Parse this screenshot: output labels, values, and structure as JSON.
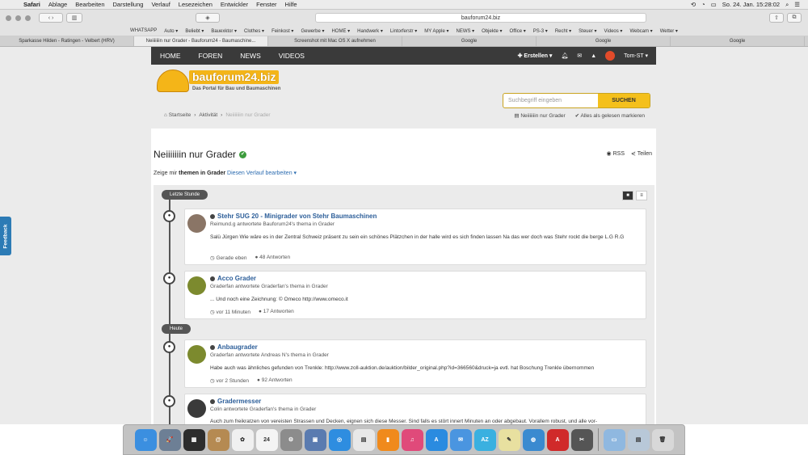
{
  "menubar": {
    "apple": "",
    "items": [
      "Safari",
      "Ablage",
      "Bearbeiten",
      "Darstellung",
      "Verlauf",
      "Lesezeichen",
      "Entwickler",
      "Fenster",
      "Hilfe"
    ],
    "clock": "So. 24. Jan.  15:28:02"
  },
  "toolbar": {
    "url": "bauforum24.biz"
  },
  "favorites": [
    "WHATSAPP",
    "Auto ▾",
    "Beliebt ▾",
    "Bauexktor ▾",
    "Clothes ▾",
    "Feinkost ▾",
    "Gewerbe ▾",
    "HOME ▾",
    "Handwerk ▾",
    "Lintorferstr ▾",
    "MY Apple ▾",
    "NEWS ▾",
    "Objekte ▾",
    "Office ▾",
    "PS-3 ▾",
    "Recht ▾",
    "Steuer ▾",
    "Videos ▾",
    "Webcam ▾",
    "Wetter ▾"
  ],
  "tabs": [
    {
      "label": "Sparkasse Hilden - Ratingen - Velbert (HRV)",
      "active": false
    },
    {
      "label": "Neiiiiiiin nur Grader - Bauforum24 - Baumaschine...",
      "active": true
    },
    {
      "label": "Screenshot mit Mac OS X aufnehmen",
      "active": false
    },
    {
      "label": "Google",
      "active": false
    },
    {
      "label": "Google",
      "active": false
    },
    {
      "label": "Google",
      "active": false
    }
  ],
  "feedback": "Feedback",
  "nav": {
    "items": [
      "HOME",
      "FOREN",
      "NEWS",
      "VIDEOS"
    ],
    "create": "✚ Erstellen ▾",
    "user": "Tom-ST ▾"
  },
  "logo": {
    "brand": "bauforum24.biz",
    "tagline": "Das Portal für Bau und Baumaschinen"
  },
  "search": {
    "placeholder": "Suchbegriff eingeben",
    "button": "SUCHEN"
  },
  "breadcrumb": {
    "home": "⌂ Startseite",
    "sep": "›",
    "activity": "Aktivität",
    "current": "Neiiiiiiin nur Grader"
  },
  "crumb_actions": {
    "stream": "▤ Neiiiiiiin nur Grader",
    "mark_read": "✔ Alles als gelesen markieren"
  },
  "page": {
    "title": "Neiiiiiiin nur Grader",
    "rss": "RSS",
    "share": "Teilen",
    "filter_prefix": "Zeige mir ",
    "filter_bold": "themen in Grader",
    "filter_link": " Diesen Verlauf bearbeiten ▾"
  },
  "stream": {
    "group1": "Letzte Stunde",
    "group2": "Heute",
    "items": [
      {
        "title": "Stehr SUG 20 - Minigrader von Stehr Baumaschinen",
        "sub": "Reimund.g antwortete Bauforum24's thema in Grader",
        "body": "Salü Jürgen Wie wäre es in der Zentral Schweiz präsent zu sein ein schönes Plätzchen in der halle wird es sich  finden lassen Na das wer doch was Stehr rockt die berge L.G R.G",
        "time": "Gerade eben",
        "replies": "48 Antworten"
      },
      {
        "title": "Acco Grader",
        "sub": "Graderfan antwortete Graderfan's thema in Grader",
        "body": "... Und noch eine Zeichnung: © Omeco http://www.omeco.it",
        "time": "vor 11 Minuten",
        "replies": "17 Antworten"
      },
      {
        "title": "Anbaugrader",
        "sub": "Graderfan antwortete Andreas N's thema in Grader",
        "body": "Habe auch was ähnliches gefunden von Trenkle: http://www.zoll-auktion.de/auktion/bilder_original.php?id=366560&druck=ja evtl. hat Boschung Trenkle übernommen",
        "time": "vor 2 Stunden",
        "replies": "92 Antworten"
      },
      {
        "title": "Gradermesser",
        "sub": "Colin antwortete Graderfan's thema in Grader",
        "body": "Auch zum freikratzen von vereisten Strassen und Decken, eignen sich diese Messer. Sind falls es stört innert Minuten an oder abgebaut. Vorallem robust, und alle vor-",
        "time": "",
        "replies": ""
      }
    ]
  },
  "dock": {
    "apps": [
      {
        "name": "finder-icon",
        "label": "☺",
        "color": "#3b8fe0"
      },
      {
        "name": "launchpad-icon",
        "label": "🚀",
        "color": "#6d7f95"
      },
      {
        "name": "mission-control-icon",
        "label": "▦",
        "color": "#2d2d2d"
      },
      {
        "name": "contacts-icon",
        "label": "@",
        "color": "#b58a52"
      },
      {
        "name": "photos-icon",
        "label": "✿",
        "color": "#f0f0f0"
      },
      {
        "name": "calendar-icon",
        "label": "24",
        "color": "#f4f4f4"
      },
      {
        "name": "system-preferences-icon",
        "label": "⚙",
        "color": "#8c8c8c"
      },
      {
        "name": "preview-icon",
        "label": "▣",
        "color": "#5a7bb0"
      },
      {
        "name": "safari-icon",
        "label": "◎",
        "color": "#2e8de0"
      },
      {
        "name": "ibooks-icon",
        "label": "▤",
        "color": "#e8e8e8"
      },
      {
        "name": "books-icon",
        "label": "▮",
        "color": "#f08a1c"
      },
      {
        "name": "itunes-icon",
        "label": "♫",
        "color": "#e04a7a"
      },
      {
        "name": "app-store-icon",
        "label": "A",
        "color": "#2a8be0"
      },
      {
        "name": "mail-icon",
        "label": "✉",
        "color": "#4a95e0"
      },
      {
        "name": "azuro-icon",
        "label": "AZ",
        "color": "#3ab0e0"
      },
      {
        "name": "notes-icon",
        "label": "✎",
        "color": "#e8e0a0"
      },
      {
        "name": "globe-icon",
        "label": "◍",
        "color": "#3a8ad0"
      },
      {
        "name": "acrobat-icon",
        "label": "A",
        "color": "#d02a2a"
      },
      {
        "name": "utility-icon",
        "label": "✂",
        "color": "#555555"
      }
    ],
    "right": [
      {
        "name": "folder-icon",
        "label": "▭",
        "color": "#8fb8e0"
      },
      {
        "name": "documents-icon",
        "label": "▤",
        "color": "#b8c8d8"
      },
      {
        "name": "trash-icon",
        "label": "🗑",
        "color": "#d8d8d8"
      }
    ]
  }
}
